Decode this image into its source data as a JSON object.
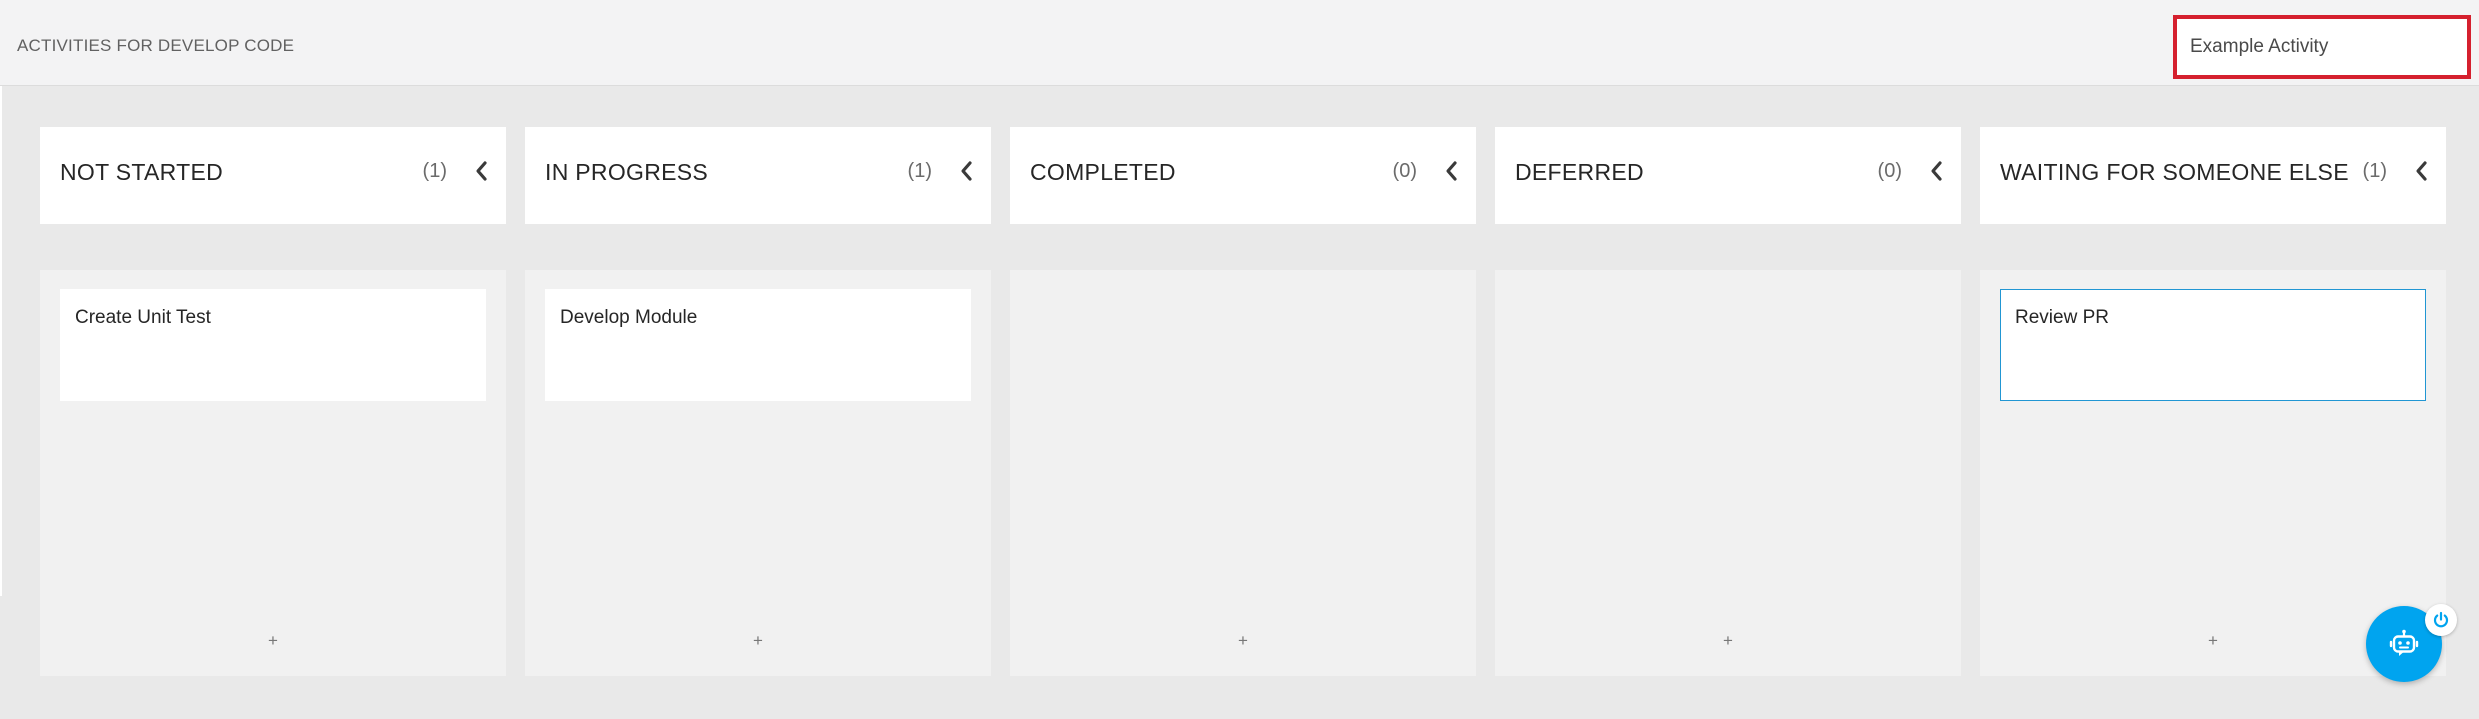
{
  "page": {
    "title": "ACTIVITIES FOR DEVELOP CODE"
  },
  "search": {
    "value": "",
    "placeholder": "Example Activity"
  },
  "columns": [
    {
      "title": "NOT STARTED",
      "count": "(1)",
      "cards": [
        "Create Unit Test"
      ],
      "add_label": "+"
    },
    {
      "title": "IN PROGRESS",
      "count": "(1)",
      "cards": [
        "Develop Module"
      ],
      "add_label": "+"
    },
    {
      "title": "COMPLETED",
      "count": "(0)",
      "cards": [],
      "add_label": "+"
    },
    {
      "title": "DEFERRED",
      "count": "(0)",
      "cards": [],
      "add_label": "+"
    },
    {
      "title": "WAITING FOR SOMEONE ELSE",
      "count": "(1)",
      "cards": [
        "Review PR"
      ],
      "add_label": "+"
    }
  ],
  "icons": {
    "collapse": "chevron-left-icon",
    "assistant": "robot-assistant-icon",
    "power": "power-icon"
  },
  "colors": {
    "accent": "#00a4ef",
    "highlight_border": "#d5202e",
    "selected_card_border": "#2196d3"
  }
}
